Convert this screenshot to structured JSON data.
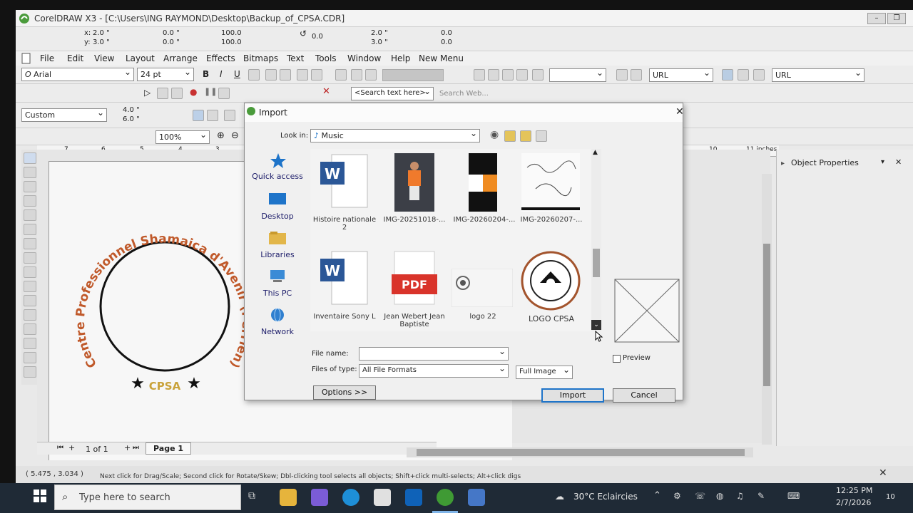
{
  "window": {
    "title": "CorelDRAW X3 - [C:\\Users\\ING RAYMOND\\Desktop\\Backup_of_CPSA.CDR]"
  },
  "propbar": {
    "x": "2.0 \"",
    "y": "3.0 \"",
    "w": "0.0 \"",
    "h": "0.0 \"",
    "scale_w": "100.0",
    "scale_h": "100.0",
    "angle": "0.0",
    "pos_x": "2.0 \"",
    "pos_y": "3.0 \"",
    "offset_x": "0.0",
    "offset_y": "0.0"
  },
  "menu": [
    "File",
    "Edit",
    "View",
    "Layout",
    "Arrange",
    "Effects",
    "Bitmaps",
    "Text",
    "Tools",
    "Window",
    "Help",
    "New Menu"
  ],
  "textbar": {
    "font": "Arial",
    "size": "24 pt",
    "url_label": "URL",
    "url_field": "URL",
    "search_placeholder": "<Search text here>",
    "search_web": "Search Web..."
  },
  "paperbar": {
    "preset": "Custom",
    "width": "4.0 \"",
    "height": "6.0 \"",
    "zoom": "100%"
  },
  "ruler": {
    "marks": [
      "7",
      "6",
      "5",
      "4",
      "3",
      "10",
      "11 inches"
    ]
  },
  "logo": {
    "arc_text": "Centre Professionnel Shamaica d'Avenir (Perrien)",
    "acronym": "CPSA"
  },
  "pagenav": {
    "count": "1 of 1",
    "tab": "Page 1",
    "units": "inches"
  },
  "object_properties": {
    "title": "Object Properties"
  },
  "status": {
    "coords": "( 5.475 , 3.034 )",
    "hint": "Next click for Drag/Scale; Second click for Rotate/Skew; Dbl-clicking tool selects all objects; Shift+click multi-selects; Alt+click digs"
  },
  "dialog": {
    "title": "Import",
    "look_in_label": "Look in:",
    "look_in_value": "Music",
    "places": [
      "Quick access",
      "Desktop",
      "Libraries",
      "This PC",
      "Network"
    ],
    "files": [
      {
        "name": "Histoire nationale 2",
        "kind": "word"
      },
      {
        "name": "IMG-20251018-...",
        "kind": "photo"
      },
      {
        "name": "IMG-20260204-...",
        "kind": "graphic"
      },
      {
        "name": "IMG-20260207-...",
        "kind": "signature"
      },
      {
        "name": "Inventaire Sony L",
        "kind": "word"
      },
      {
        "name": "Jean Webert Jean Baptiste",
        "kind": "pdf"
      },
      {
        "name": "logo 22",
        "kind": "logo"
      },
      {
        "name": "LOGO CPSA",
        "kind": "seal"
      }
    ],
    "file_name_label": "File name:",
    "file_name_value": "",
    "files_of_type_label": "Files of type:",
    "files_of_type_value": "All File Formats",
    "image_mode": "Full Image",
    "preview_label": "Preview",
    "pdf_badge": "PDF",
    "options_button": "Options >>",
    "import_button": "Import",
    "cancel_button": "Cancel"
  },
  "taskbar": {
    "search_placeholder": "Type here to search",
    "weather": "30°C  Eclaircies",
    "time": "12:25 PM",
    "date": "2/7/2026",
    "notif_count": "10"
  },
  "colors": {
    "arc_orange": "#c0592a",
    "cpsa_gold": "#c9a23a",
    "taskbar": "#1f2a36",
    "accent_blue": "#1e74c9"
  }
}
